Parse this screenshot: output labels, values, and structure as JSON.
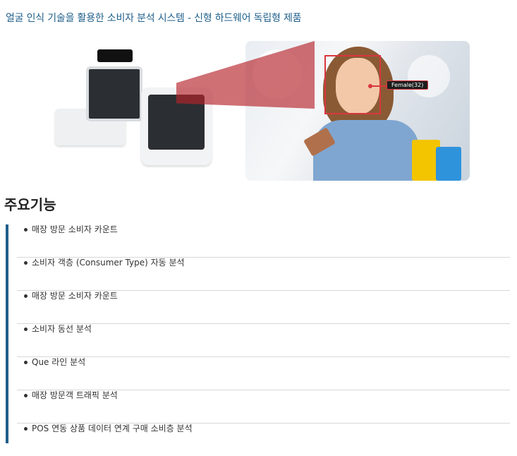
{
  "page": {
    "title": "얼굴 인식 기술을 활용한 소비자 분석 시스템 - 신형 하드웨어 독립형 제품"
  },
  "hero": {
    "face_tag": "Female(32)",
    "accent_color": "#d9363e"
  },
  "section": {
    "title": "주요기능"
  },
  "features": [
    "매장 방문 소비자 카운트",
    "소비자 객층 (Consumer Type) 자동 분석",
    "매장 방문 소비자 카운트",
    "소비자 동선 분석",
    "Que 라인 분석",
    "매장 방문객 트래픽 분석",
    "POS 연동 상품 데이터 연계 구매 소비층 분석"
  ],
  "colors": {
    "title_blue": "#1f5f8b",
    "divider": "#d7d7d7"
  }
}
